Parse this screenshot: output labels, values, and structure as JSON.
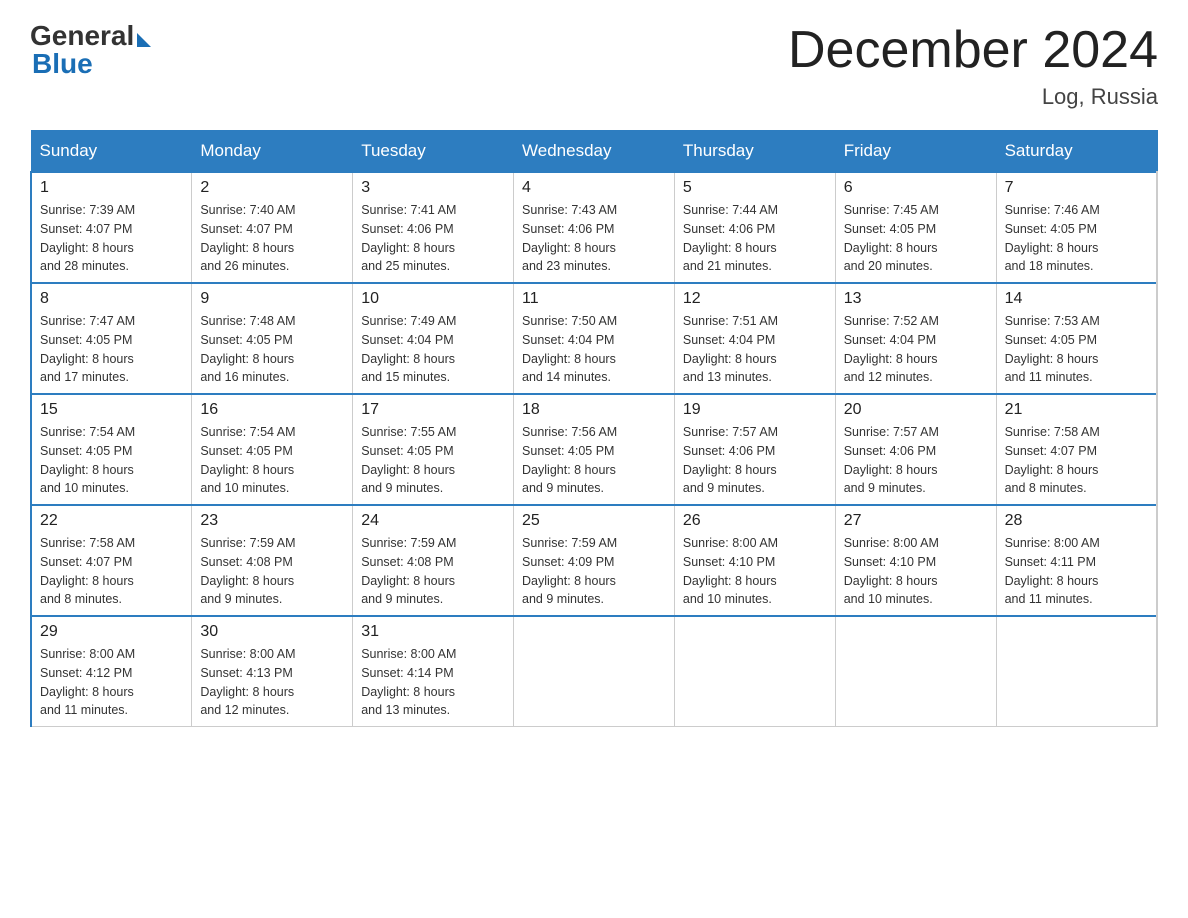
{
  "logo": {
    "general": "General",
    "blue": "Blue"
  },
  "title": "December 2024",
  "location": "Log, Russia",
  "days_of_week": [
    "Sunday",
    "Monday",
    "Tuesday",
    "Wednesday",
    "Thursday",
    "Friday",
    "Saturday"
  ],
  "weeks": [
    [
      {
        "day": "1",
        "sunrise": "7:39 AM",
        "sunset": "4:07 PM",
        "daylight": "8 hours and 28 minutes."
      },
      {
        "day": "2",
        "sunrise": "7:40 AM",
        "sunset": "4:07 PM",
        "daylight": "8 hours and 26 minutes."
      },
      {
        "day": "3",
        "sunrise": "7:41 AM",
        "sunset": "4:06 PM",
        "daylight": "8 hours and 25 minutes."
      },
      {
        "day": "4",
        "sunrise": "7:43 AM",
        "sunset": "4:06 PM",
        "daylight": "8 hours and 23 minutes."
      },
      {
        "day": "5",
        "sunrise": "7:44 AM",
        "sunset": "4:06 PM",
        "daylight": "8 hours and 21 minutes."
      },
      {
        "day": "6",
        "sunrise": "7:45 AM",
        "sunset": "4:05 PM",
        "daylight": "8 hours and 20 minutes."
      },
      {
        "day": "7",
        "sunrise": "7:46 AM",
        "sunset": "4:05 PM",
        "daylight": "8 hours and 18 minutes."
      }
    ],
    [
      {
        "day": "8",
        "sunrise": "7:47 AM",
        "sunset": "4:05 PM",
        "daylight": "8 hours and 17 minutes."
      },
      {
        "day": "9",
        "sunrise": "7:48 AM",
        "sunset": "4:05 PM",
        "daylight": "8 hours and 16 minutes."
      },
      {
        "day": "10",
        "sunrise": "7:49 AM",
        "sunset": "4:04 PM",
        "daylight": "8 hours and 15 minutes."
      },
      {
        "day": "11",
        "sunrise": "7:50 AM",
        "sunset": "4:04 PM",
        "daylight": "8 hours and 14 minutes."
      },
      {
        "day": "12",
        "sunrise": "7:51 AM",
        "sunset": "4:04 PM",
        "daylight": "8 hours and 13 minutes."
      },
      {
        "day": "13",
        "sunrise": "7:52 AM",
        "sunset": "4:04 PM",
        "daylight": "8 hours and 12 minutes."
      },
      {
        "day": "14",
        "sunrise": "7:53 AM",
        "sunset": "4:05 PM",
        "daylight": "8 hours and 11 minutes."
      }
    ],
    [
      {
        "day": "15",
        "sunrise": "7:54 AM",
        "sunset": "4:05 PM",
        "daylight": "8 hours and 10 minutes."
      },
      {
        "day": "16",
        "sunrise": "7:54 AM",
        "sunset": "4:05 PM",
        "daylight": "8 hours and 10 minutes."
      },
      {
        "day": "17",
        "sunrise": "7:55 AM",
        "sunset": "4:05 PM",
        "daylight": "8 hours and 9 minutes."
      },
      {
        "day": "18",
        "sunrise": "7:56 AM",
        "sunset": "4:05 PM",
        "daylight": "8 hours and 9 minutes."
      },
      {
        "day": "19",
        "sunrise": "7:57 AM",
        "sunset": "4:06 PM",
        "daylight": "8 hours and 9 minutes."
      },
      {
        "day": "20",
        "sunrise": "7:57 AM",
        "sunset": "4:06 PM",
        "daylight": "8 hours and 9 minutes."
      },
      {
        "day": "21",
        "sunrise": "7:58 AM",
        "sunset": "4:07 PM",
        "daylight": "8 hours and 8 minutes."
      }
    ],
    [
      {
        "day": "22",
        "sunrise": "7:58 AM",
        "sunset": "4:07 PM",
        "daylight": "8 hours and 8 minutes."
      },
      {
        "day": "23",
        "sunrise": "7:59 AM",
        "sunset": "4:08 PM",
        "daylight": "8 hours and 9 minutes."
      },
      {
        "day": "24",
        "sunrise": "7:59 AM",
        "sunset": "4:08 PM",
        "daylight": "8 hours and 9 minutes."
      },
      {
        "day": "25",
        "sunrise": "7:59 AM",
        "sunset": "4:09 PM",
        "daylight": "8 hours and 9 minutes."
      },
      {
        "day": "26",
        "sunrise": "8:00 AM",
        "sunset": "4:10 PM",
        "daylight": "8 hours and 10 minutes."
      },
      {
        "day": "27",
        "sunrise": "8:00 AM",
        "sunset": "4:10 PM",
        "daylight": "8 hours and 10 minutes."
      },
      {
        "day": "28",
        "sunrise": "8:00 AM",
        "sunset": "4:11 PM",
        "daylight": "8 hours and 11 minutes."
      }
    ],
    [
      {
        "day": "29",
        "sunrise": "8:00 AM",
        "sunset": "4:12 PM",
        "daylight": "8 hours and 11 minutes."
      },
      {
        "day": "30",
        "sunrise": "8:00 AM",
        "sunset": "4:13 PM",
        "daylight": "8 hours and 12 minutes."
      },
      {
        "day": "31",
        "sunrise": "8:00 AM",
        "sunset": "4:14 PM",
        "daylight": "8 hours and 13 minutes."
      },
      null,
      null,
      null,
      null
    ]
  ],
  "labels": {
    "sunrise": "Sunrise:",
    "sunset": "Sunset:",
    "daylight": "Daylight:"
  }
}
